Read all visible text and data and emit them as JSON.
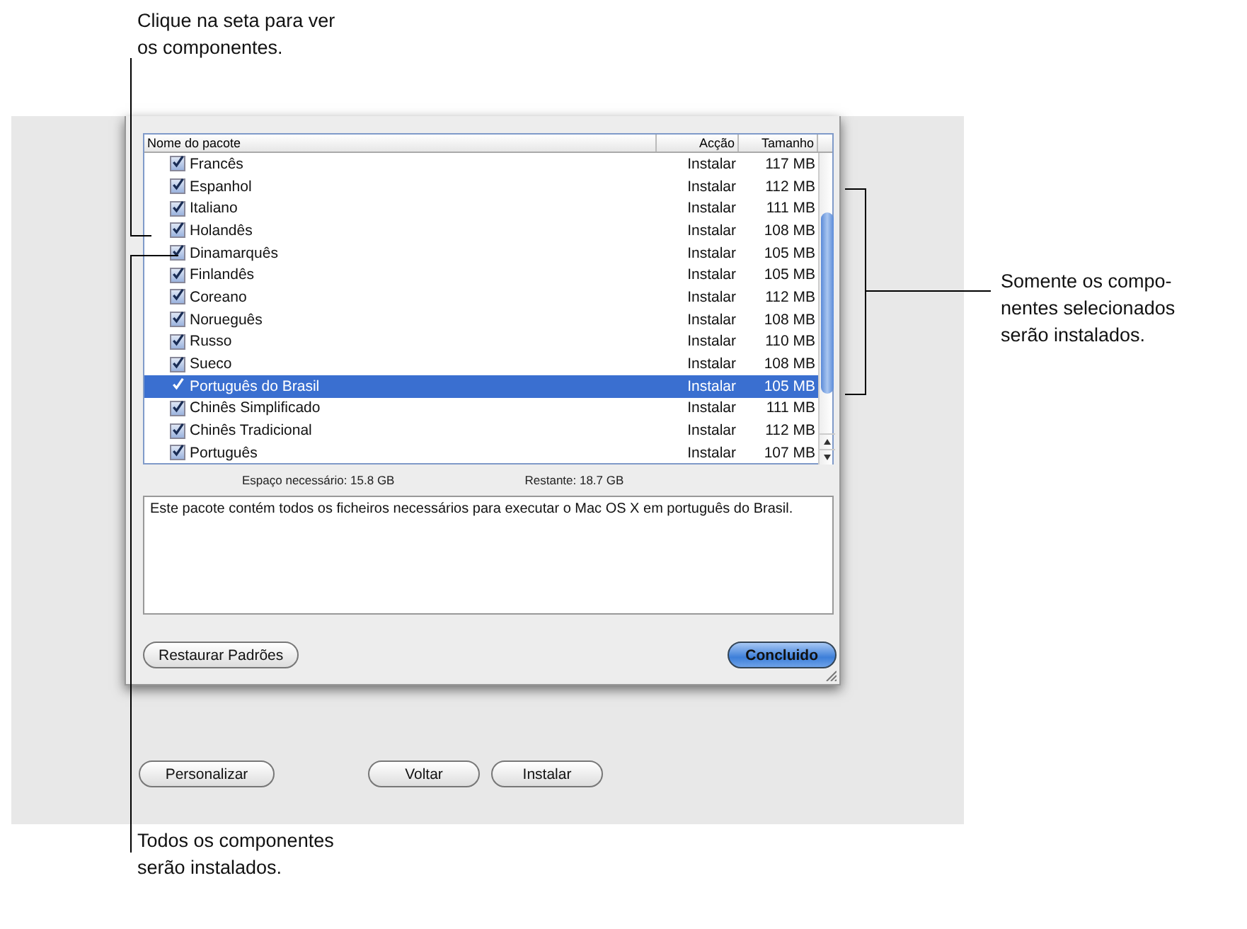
{
  "callouts": [
    {
      "text": "Clique na seta para ver os componentes."
    },
    {
      "text": "Somente os compo-nentes selecionados serão instalados."
    },
    {
      "text": "Todos os componentes serão instalados."
    }
  ],
  "table": {
    "columns": [
      "Nome do pacote",
      "Acção",
      "Tamanho"
    ],
    "rows": [
      {
        "name": "Francês",
        "checked": true,
        "action": "Instalar",
        "size": "117 MB",
        "selected": false
      },
      {
        "name": "Espanhol",
        "checked": true,
        "action": "Instalar",
        "size": "112 MB",
        "selected": false
      },
      {
        "name": "Italiano",
        "checked": true,
        "action": "Instalar",
        "size": "111 MB",
        "selected": false
      },
      {
        "name": "Holandês",
        "checked": true,
        "action": "Instalar",
        "size": "108 MB",
        "selected": false
      },
      {
        "name": "Dinamarquês",
        "checked": true,
        "action": "Instalar",
        "size": "105 MB",
        "selected": false
      },
      {
        "name": "Finlandês",
        "checked": true,
        "action": "Instalar",
        "size": "105 MB",
        "selected": false
      },
      {
        "name": "Coreano",
        "checked": true,
        "action": "Instalar",
        "size": "112 MB",
        "selected": false
      },
      {
        "name": "Norueguês",
        "checked": true,
        "action": "Instalar",
        "size": "108 MB",
        "selected": false
      },
      {
        "name": "Russo",
        "checked": true,
        "action": "Instalar",
        "size": "110 MB",
        "selected": false
      },
      {
        "name": "Sueco",
        "checked": true,
        "action": "Instalar",
        "size": "108 MB",
        "selected": false
      },
      {
        "name": "Português do Brasil",
        "checked": true,
        "action": "Instalar",
        "size": "105 MB",
        "selected": true
      },
      {
        "name": "Chinês Simplificado",
        "checked": true,
        "action": "Instalar",
        "size": "111 MB",
        "selected": false
      },
      {
        "name": "Chinês Tradicional",
        "checked": true,
        "action": "Instalar",
        "size": "112 MB",
        "selected": false
      },
      {
        "name": "Português",
        "checked": true,
        "action": "Instalar",
        "size": "107 MB",
        "selected": false
      }
    ]
  },
  "space": {
    "required": "Espaço necessário:  15.8 GB",
    "remaining": "Restante:  18.7 GB"
  },
  "description": "Este pacote contém todos os ficheiros necessários para executar o Mac OS X em português do Brasil.",
  "sheet_buttons": [
    {
      "label": "Restaurar Padrões",
      "kind": "normal"
    },
    {
      "label": "Concluido",
      "kind": "default"
    }
  ],
  "buttons": [
    "Personalizar",
    "Voltar",
    "Instalar"
  ]
}
